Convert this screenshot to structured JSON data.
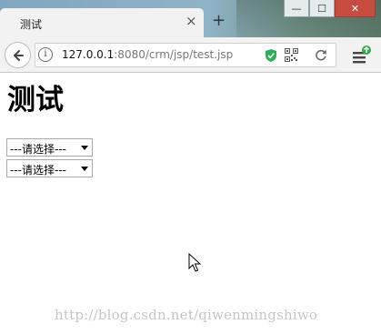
{
  "browser": {
    "tab_title": "测试",
    "tab_close": "×",
    "new_tab": "+",
    "address": {
      "host": "127.0.0.1",
      "rest": ":8080/crm/jsp/test.jsp"
    },
    "window_controls": {
      "minimize": "—",
      "maximize": "☐",
      "close": "✕"
    },
    "icons": [
      "back-arrow-icon",
      "info-icon",
      "shield-icon",
      "qr-code-icon",
      "reload-icon",
      "menu-icon"
    ]
  },
  "page": {
    "heading": "测试",
    "selects": [
      {
        "value": "---请选择---"
      },
      {
        "value": "---请选择---"
      }
    ],
    "watermark": "http://blog.csdn.net/qiwenmingshiwo"
  },
  "colors": {
    "shield": "#2fae5a",
    "update_badge": "#35a84a",
    "close_button": "#c74b3f"
  }
}
